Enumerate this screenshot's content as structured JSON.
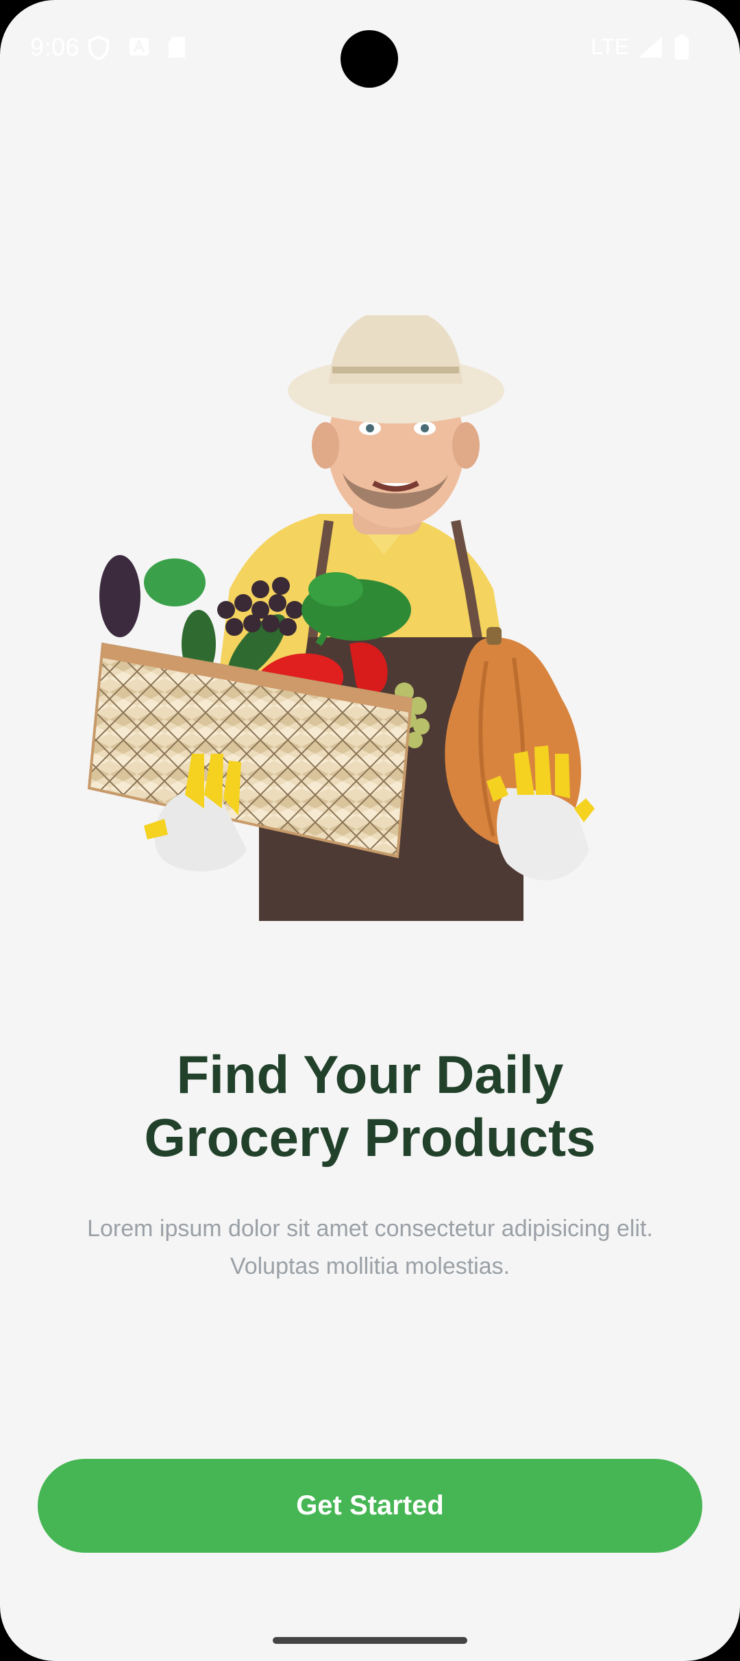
{
  "status_bar": {
    "time": "9:06",
    "network": "LTE",
    "icons": [
      "shield-icon",
      "font-icon",
      "sd-card-icon",
      "signal-icon",
      "battery-icon"
    ]
  },
  "hero": {
    "icon": "grocery-farmer-illustration"
  },
  "onboarding": {
    "title_line1": "Find Your Daily",
    "title_line2": "Grocery Products",
    "subtitle_line1": "Lorem ipsum dolor sit amet consectetur adipisicing elit.",
    "subtitle_line2": "Voluptas mollitia molestias.",
    "button_label": "Get Started"
  },
  "colors": {
    "background": "#f5f5f5",
    "title": "#22412b",
    "subtitle": "#9aa0a6",
    "accent": "#45b653"
  }
}
